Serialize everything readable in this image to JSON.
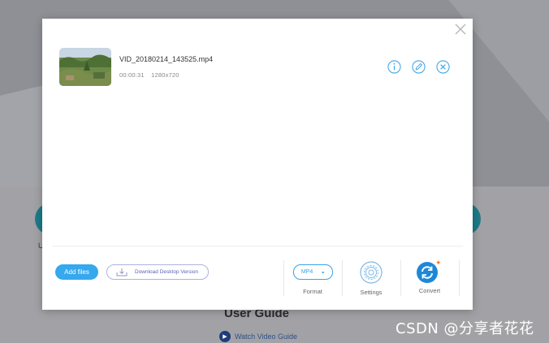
{
  "background": {
    "side_label": "U",
    "heading": "User Guide",
    "video_link": "Watch Video Guide"
  },
  "modal": {
    "close_icon": "close-icon",
    "file": {
      "name": "VID_20180214_143525.mp4",
      "duration": "00:00:31",
      "resolution": "1280x720",
      "actions": [
        "info-icon",
        "edit-icon",
        "remove-icon"
      ]
    },
    "footer": {
      "add_files_label": "Add files",
      "download_label": "Download Desktop Version",
      "format_value": "MP4",
      "format_label": "Format",
      "settings_label": "Settings",
      "convert_label": "Convert"
    }
  },
  "watermark": "CSDN @分享者花花",
  "colors": {
    "accent": "#35a8ee",
    "convert_blue": "#1e88d8",
    "convert_badge": "#f57c3a",
    "download_border": "#aab3dd",
    "download_text": "#5b63b8",
    "overlay_bg": "#9a9a9f",
    "circle_teal": "#1e7b88"
  }
}
